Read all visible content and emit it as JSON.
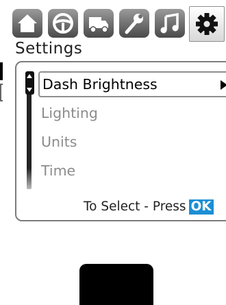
{
  "tabs": [
    {
      "icon": "home-icon"
    },
    {
      "icon": "steering-wheel-icon"
    },
    {
      "icon": "truck-icon"
    },
    {
      "icon": "wrench-icon"
    },
    {
      "icon": "music-note-icon"
    },
    {
      "icon": "gear-icon",
      "active": true
    }
  ],
  "page_title": "Settings",
  "menu": {
    "items": [
      {
        "label": "Dash Brightness",
        "selected": true
      },
      {
        "label": "Lighting"
      },
      {
        "label": "Units"
      },
      {
        "label": "Time"
      }
    ]
  },
  "footer": {
    "prompt": "To Select - Press",
    "ok_label": "OK"
  },
  "colors": {
    "ok_badge": "#1b8fd4",
    "tab_inactive": "#6a6a6a",
    "item_disabled": "#8c8c8c"
  }
}
